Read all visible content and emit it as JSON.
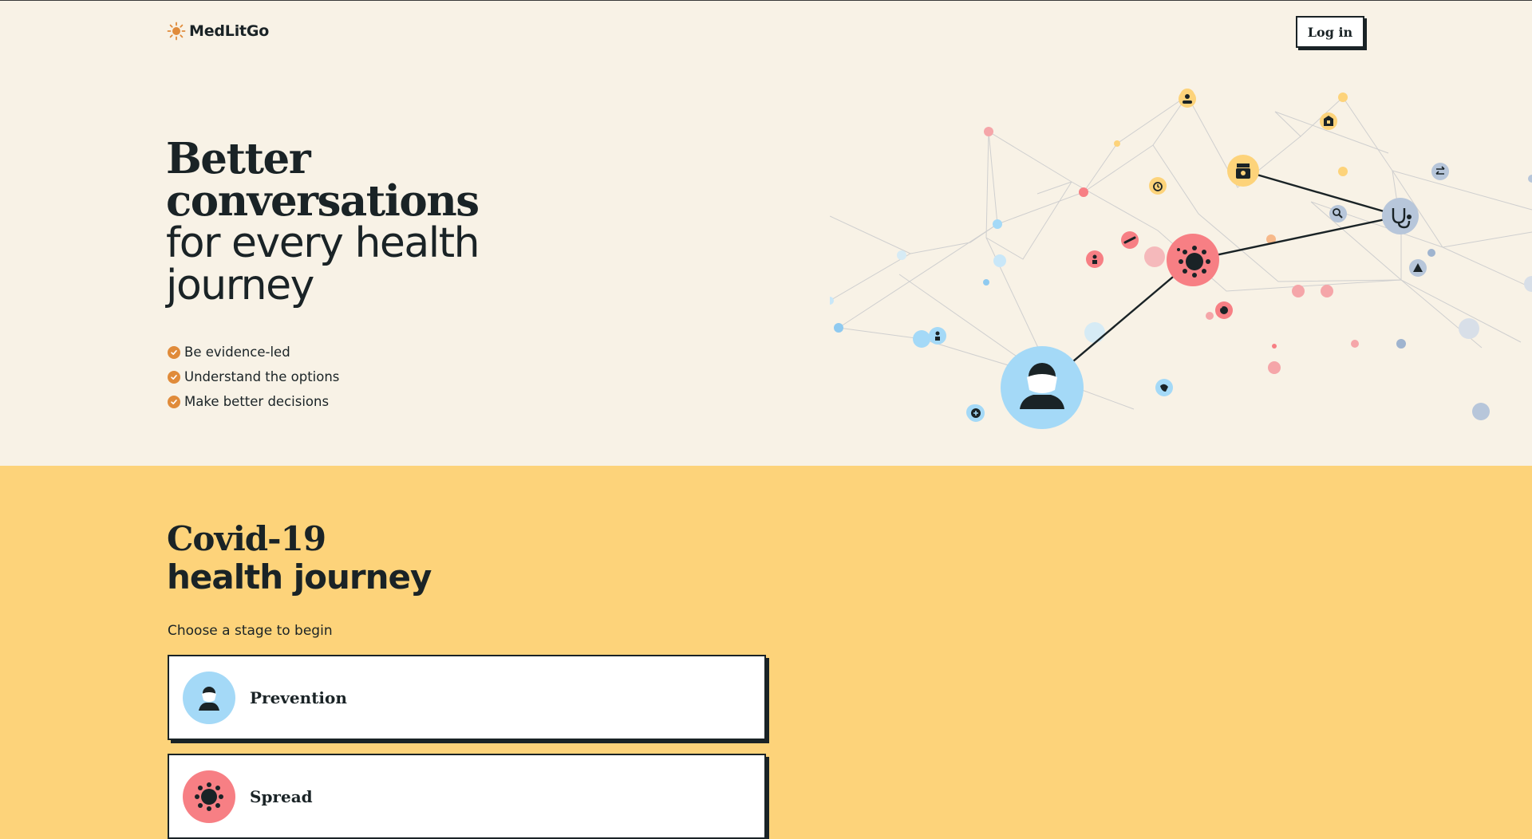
{
  "brand": {
    "name": "MedLitGo",
    "accent": "#e08b3a"
  },
  "header": {
    "login_label": "Log in"
  },
  "hero": {
    "title_bold": "Better conversations",
    "title_light": "for every health journey",
    "benefits": [
      "Be evidence-led",
      "Understand the options",
      "Make better decisions"
    ]
  },
  "network_icons": [
    "person-mask-icon",
    "virus-icon",
    "stethoscope-icon",
    "medicine-bottle-icon",
    "hospital-icon",
    "doctor-icon",
    "search-icon",
    "alert-icon",
    "first-aid-icon",
    "hand-care-icon",
    "globe-virus-icon",
    "clock-icon"
  ],
  "journey": {
    "title_bold": "Covid-19",
    "title_light": "health journey",
    "prompt": "Choose a stage to begin",
    "stages": [
      {
        "label": "Prevention",
        "icon": "person-mask-icon",
        "color": "#a4d9f7"
      },
      {
        "label": "Spread",
        "icon": "virus-icon",
        "color": "#f77f84"
      }
    ]
  },
  "colors": {
    "hero_bg": "#f8f2e6",
    "section_bg": "#fdd37a",
    "blue": "#a4d9f7",
    "red": "#f77f84",
    "yellow": "#fdd37a",
    "grey_blue": "#b7c6da"
  }
}
